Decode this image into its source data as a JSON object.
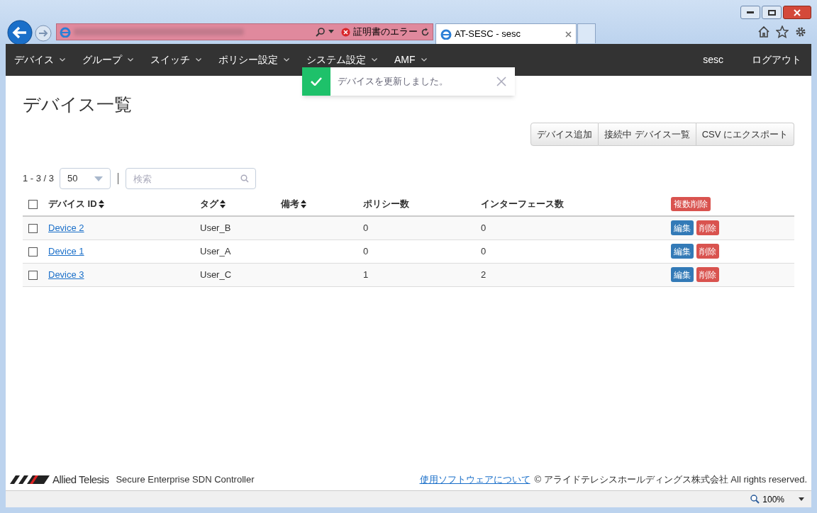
{
  "browser": {
    "address_status": "証明書のエラー",
    "tab_title": "AT-SESC - sesc",
    "zoom": "100%"
  },
  "nav": {
    "items": [
      {
        "label": "デバイス"
      },
      {
        "label": "グループ"
      },
      {
        "label": "スイッチ"
      },
      {
        "label": "ポリシー設定"
      },
      {
        "label": "システム設定"
      },
      {
        "label": "AMF"
      }
    ],
    "user": "sesc",
    "logout": "ログアウト"
  },
  "toast": {
    "kind": "success",
    "message": "デバイスを更新しました。"
  },
  "page_title": "デバイス一覧",
  "actions": [
    "デバイス追加",
    "接続中 デバイス一覧",
    "CSV にエクスポート"
  ],
  "pager": {
    "range": "1 - 3 / 3",
    "page_size": "50",
    "search_placeholder": "検索"
  },
  "table": {
    "select_all_checked": false,
    "columns": [
      {
        "label": "デバイス ID",
        "sortable": true
      },
      {
        "label": "タグ",
        "sortable": true
      },
      {
        "label": "備考",
        "sortable": true
      },
      {
        "label": "ポリシー数",
        "sortable": false
      },
      {
        "label": "インターフェース数",
        "sortable": false
      }
    ],
    "bulk_delete": "複数削除",
    "rows": [
      {
        "checked": false,
        "device": "Device 2",
        "tag": "User_B",
        "policies": "0",
        "interfaces": "0",
        "edit": "編集",
        "delete": "削除"
      },
      {
        "checked": false,
        "device": "Device 1",
        "tag": "User_A",
        "policies": "0",
        "interfaces": "0",
        "edit": "編集",
        "delete": "削除"
      },
      {
        "checked": false,
        "device": "Device 3",
        "tag": "User_C",
        "policies": "1",
        "interfaces": "2",
        "edit": "編集",
        "delete": "削除"
      }
    ]
  },
  "footer": {
    "brand": "Allied Telesis",
    "product": "Secure Enterprise SDN Controller",
    "link": "使用ソフトウェアについて",
    "copyright": "© アライドテレシスホールディングス株式会社 All rights reserved."
  }
}
